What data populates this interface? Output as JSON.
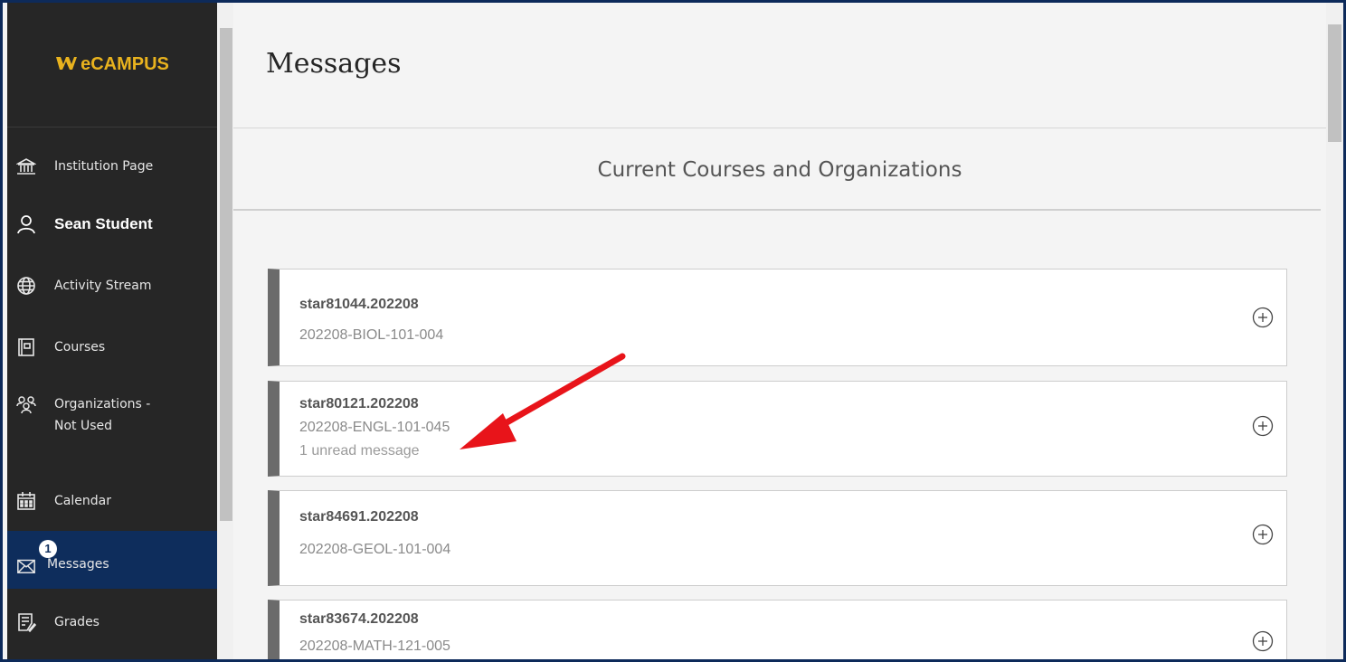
{
  "brand": {
    "logo": "ecampus-logo-icon",
    "text": "eCAMPUS"
  },
  "sidebar": {
    "items": [
      {
        "label": "Institution Page",
        "icon": "institution-icon"
      },
      {
        "label": "Sean Student",
        "icon": "user-icon"
      },
      {
        "label": "Activity Stream",
        "icon": "globe-icon"
      },
      {
        "label": "Courses",
        "icon": "book-icon"
      },
      {
        "label": "Organizations - Not Used",
        "line1": "Organizations -",
        "line2": "Not Used",
        "icon": "organizations-icon"
      },
      {
        "label": "Calendar",
        "icon": "calendar-icon"
      },
      {
        "label": "Messages",
        "icon": "envelope-icon",
        "badge": "1"
      },
      {
        "label": "Grades",
        "icon": "grades-icon"
      }
    ]
  },
  "main": {
    "title": "Messages",
    "section_title": "Current Courses and Organizations",
    "courses": [
      {
        "code": "star81044.202208",
        "name": "202208-BIOL-101-004",
        "unread": ""
      },
      {
        "code": "star80121.202208",
        "name": "202208-ENGL-101-045",
        "unread": "1 unread message"
      },
      {
        "code": "star84691.202208",
        "name": "202208-GEOL-101-004",
        "unread": ""
      },
      {
        "code": "star83674.202208",
        "name": "202208-MATH-121-005",
        "unread": ""
      }
    ]
  },
  "colors": {
    "sidebar_bg": "#262626",
    "active_bg": "#0e2d5c",
    "brand_gold": "#e8b21e",
    "annotation_arrow": "#e8141a"
  }
}
